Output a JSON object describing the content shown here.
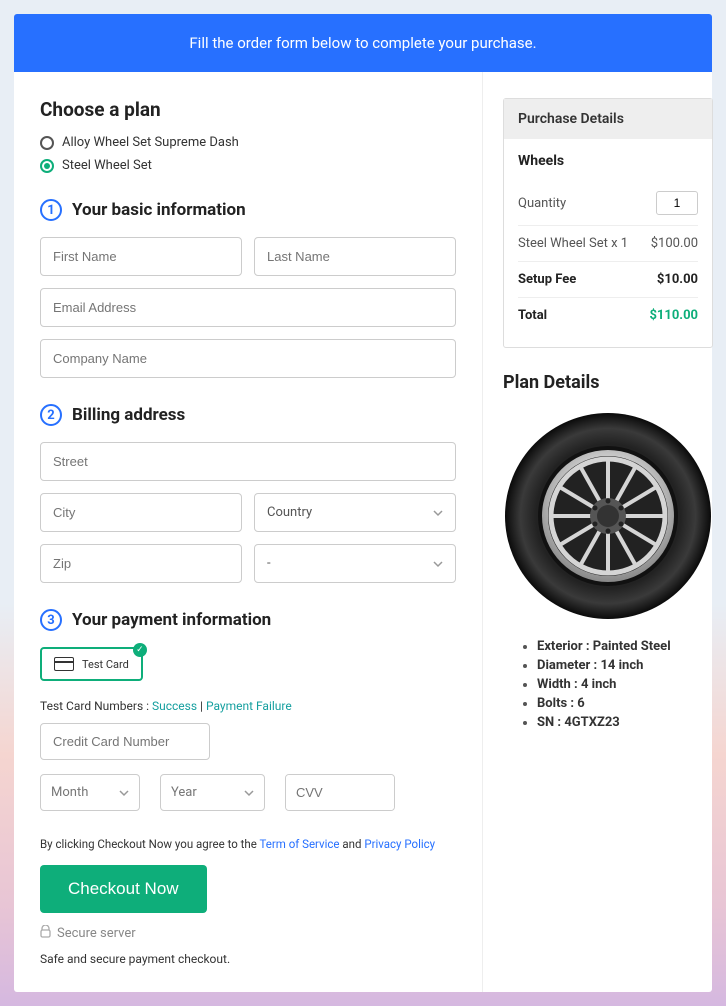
{
  "banner": "Fill the order form below to complete your purchase.",
  "plan": {
    "title": "Choose a plan",
    "options": [
      {
        "label": "Alloy Wheel Set Supreme Dash",
        "selected": false
      },
      {
        "label": "Steel Wheel Set",
        "selected": true
      }
    ]
  },
  "sections": {
    "basic": {
      "num": "1",
      "title": "Your basic information"
    },
    "billing": {
      "num": "2",
      "title": "Billing address"
    },
    "payment": {
      "num": "3",
      "title": "Your payment information"
    }
  },
  "inputs": {
    "first_name": "First Name",
    "last_name": "Last Name",
    "email": "Email Address",
    "company": "Company Name",
    "street": "Street",
    "city": "City",
    "country": "Country",
    "zip": "Zip",
    "state": "-",
    "cc": "Credit Card Number",
    "month": "Month",
    "year": "Year",
    "cvv": "CVV"
  },
  "card": {
    "label": "Test  Card"
  },
  "test_card": {
    "prefix": "Test Card Numbers : ",
    "success": "Success",
    "sep": " | ",
    "failure": "Payment Failure"
  },
  "tos": {
    "prefix": "By clicking Checkout Now you agree to the ",
    "tos": "Term of Service",
    "and": " and ",
    "pp": "Privacy Policy"
  },
  "checkout": "Checkout Now",
  "secure": "Secure server",
  "safe": "Safe and secure payment checkout.",
  "purchase": {
    "title": "Purchase Details",
    "sub": "Wheels",
    "qty_label": "Quantity",
    "qty_value": "1",
    "line_label": "Steel Wheel Set x 1",
    "line_value": "$100.00",
    "fee_label": "Setup Fee",
    "fee_value": "$10.00",
    "total_label": "Total",
    "total_value": "$110.00"
  },
  "plan_details": {
    "title": "Plan Details",
    "bullets": [
      {
        "k": "Exterior",
        "v": "Painted Steel"
      },
      {
        "k": "Diameter",
        "v": "14 inch"
      },
      {
        "k": "Width",
        "v": "4 inch"
      },
      {
        "k": "Bolts",
        "v": "6"
      },
      {
        "k": "SN",
        "v": "4GTXZ23"
      }
    ]
  }
}
